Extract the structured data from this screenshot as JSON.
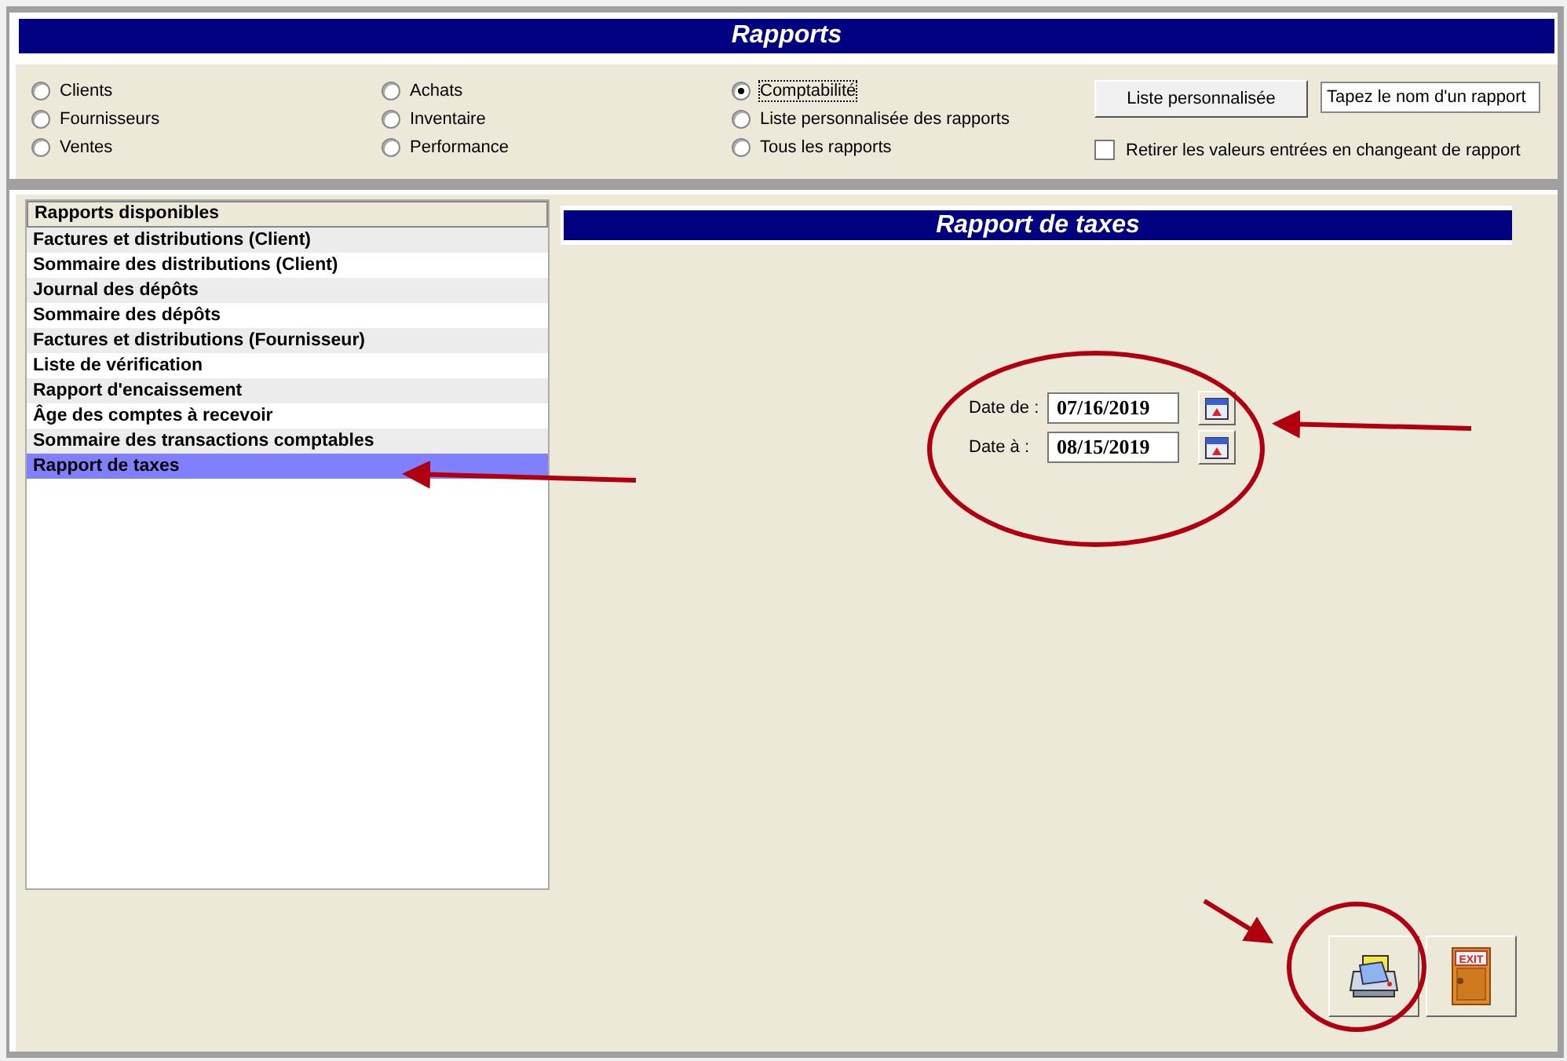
{
  "window": {
    "title": "Rapports"
  },
  "report_types": [
    {
      "label": "Clients",
      "selected": false
    },
    {
      "label": "Fournisseurs",
      "selected": false
    },
    {
      "label": "Ventes",
      "selected": false
    },
    {
      "label": "Achats",
      "selected": false
    },
    {
      "label": "Inventaire",
      "selected": false
    },
    {
      "label": "Performance",
      "selected": false
    },
    {
      "label": "Comptabilité",
      "selected": true
    },
    {
      "label": "Liste personnalisée des rapports",
      "selected": false
    },
    {
      "label": "Tous les rapports",
      "selected": false
    }
  ],
  "custom_list_button": "Liste personnalisée",
  "search": {
    "placeholder": "Tapez le nom d'un rapport"
  },
  "clear_values": {
    "label": "Retirer les valeurs entrées en changeant de rapport",
    "checked": false
  },
  "report_list": {
    "header": "Rapports disponibles",
    "items": [
      {
        "label": "Factures et distributions (Client)",
        "selected": false
      },
      {
        "label": "Sommaire des distributions (Client)",
        "selected": false
      },
      {
        "label": "Journal des dépôts",
        "selected": false
      },
      {
        "label": "Sommaire des dépôts",
        "selected": false
      },
      {
        "label": "Factures et distributions (Fournisseur)",
        "selected": false
      },
      {
        "label": "Liste de vérification",
        "selected": false
      },
      {
        "label": "Rapport d'encaissement",
        "selected": false
      },
      {
        "label": "Âge des comptes à recevoir",
        "selected": false
      },
      {
        "label": "Sommaire des transactions comptables",
        "selected": false
      },
      {
        "label": "Rapport de taxes",
        "selected": true
      }
    ]
  },
  "report_title": "Rapport de taxes",
  "dates": [
    {
      "label": "Date de :",
      "value": "07/16/2019"
    },
    {
      "label": "Date à :",
      "value": "08/15/2019"
    }
  ],
  "exit_label": "EXIT"
}
